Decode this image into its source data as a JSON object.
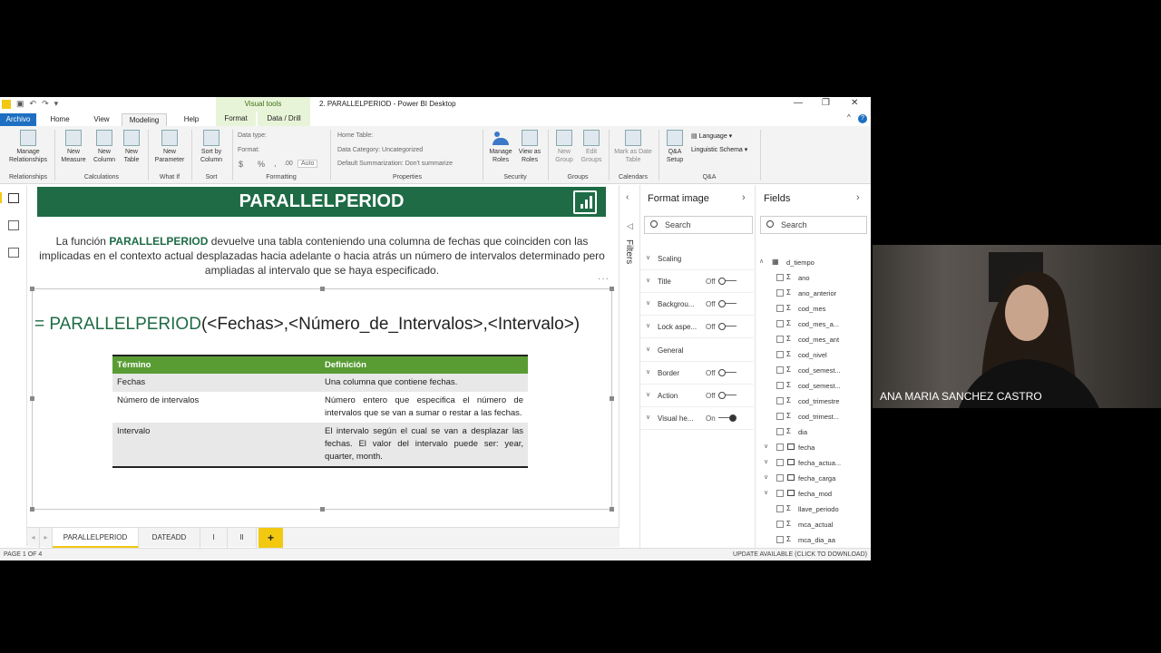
{
  "window": {
    "title": "2. PARALLELPERIOD - Power BI Desktop",
    "context_tab": "Visual tools",
    "minimize": "—",
    "restore": "❐",
    "close": "✕",
    "collapse": "^",
    "help": "?"
  },
  "tabs": [
    "Archivo",
    "Home",
    "View",
    "Modeling",
    "Help",
    "Format",
    "Data / Drill"
  ],
  "ribbon": {
    "buttons": {
      "manage_relationships": "Manage Relationships",
      "new_measure": "New Measure",
      "new_column": "New Column",
      "new_table": "New Table",
      "new_parameter": "New Parameter",
      "sort_by_column": "Sort by Column",
      "manage_roles": "Manage Roles",
      "view_as_roles": "View as Roles",
      "new_group": "New Group",
      "edit_groups": "Edit Groups",
      "mark_as_date_table": "Mark as Date Table",
      "qa_setup": "Q&A Setup",
      "language": "Language",
      "linguistic_schema": "Linguistic Schema"
    },
    "formatting": {
      "data_type": "Data type:",
      "format": "Format:",
      "currency": "$",
      "percent": "%",
      "comma": ",",
      "decimals": ".00",
      "auto": "Auto"
    },
    "properties": {
      "home_table": "Home Table:",
      "data_category": "Data Category: Uncategorized",
      "default_summarization": "Default Summarization: Don't summarize"
    },
    "groups": {
      "relationships": "Relationships",
      "calculations": "Calculations",
      "what_if": "What If",
      "sort": "Sort",
      "formatting": "Formatting",
      "properties": "Properties",
      "security": "Security",
      "groups": "Groups",
      "calendars": "Calendars",
      "qa": "Q&A"
    }
  },
  "slide": {
    "banner_title": "PARALLELPERIOD",
    "description_intro": "La función ",
    "description_bold": "PARALLELPERIOD",
    "description_rest": " devuelve una tabla conteniendo una columna de fechas que coinciden con las implicadas en el contexto actual desplazadas hacia adelante o hacia atrás un número de intervalos determinado pero ampliadas al intervalo que se haya especificado.",
    "more": "···",
    "formula_prefix": "= PARALLELPERIOD",
    "formula_args": "(<Fechas>,<Número_de_Intervalos>,<Intervalo>)",
    "table": {
      "headers": [
        "Término",
        "Definición"
      ],
      "rows": [
        [
          "Fechas",
          "Una columna que contiene fechas."
        ],
        [
          "Número de intervalos",
          "Número entero que especifica el número de intervalos que se van a sumar o restar a las fechas."
        ],
        [
          "Intervalo",
          "El intervalo según el cual se van a desplazar las fechas. El valor del intervalo puede ser: year, quarter, month."
        ]
      ]
    }
  },
  "pages": [
    "PARALLELPERIOD",
    "DATEADD",
    "I",
    "II",
    "+"
  ],
  "status": {
    "page": "PAGE 1 OF 4",
    "update": "UPDATE AVAILABLE (CLICK TO DOWNLOAD)"
  },
  "filters": {
    "label": "Filters"
  },
  "format_pane": {
    "title": "Format image",
    "search": "Search",
    "rows": [
      {
        "name": "Scaling",
        "state": ""
      },
      {
        "name": "Title",
        "state": "Off"
      },
      {
        "name": "Backgrou...",
        "state": "Off"
      },
      {
        "name": "Lock aspe...",
        "state": "Off"
      },
      {
        "name": "General",
        "state": ""
      },
      {
        "name": "Border",
        "state": "Off"
      },
      {
        "name": "Action",
        "state": "Off"
      },
      {
        "name": "Visual he...",
        "state": "On"
      }
    ]
  },
  "fields_pane": {
    "title": "Fields",
    "search": "Search",
    "table": "d_tiempo",
    "fields": [
      "ano",
      "ano_anterior",
      "cod_mes",
      "cod_mes_a...",
      "cod_mes_ant",
      "cod_nivel",
      "cod_semest...",
      "cod_semest...",
      "cod_trimestre",
      "cod_trimest...",
      "dia",
      "fecha",
      "fecha_actua...",
      "fecha_carga",
      "fecha_mod",
      "llave_periodo",
      "mca_actual",
      "mca_dia_aa"
    ]
  },
  "webcam": {
    "name": "ANA MARIA SANCHEZ CASTRO"
  },
  "colors": {
    "accent": "#f2c811",
    "brand_green": "#1e6b45",
    "table_header": "#5a9c34",
    "file_tab": "#1e6fc2"
  }
}
